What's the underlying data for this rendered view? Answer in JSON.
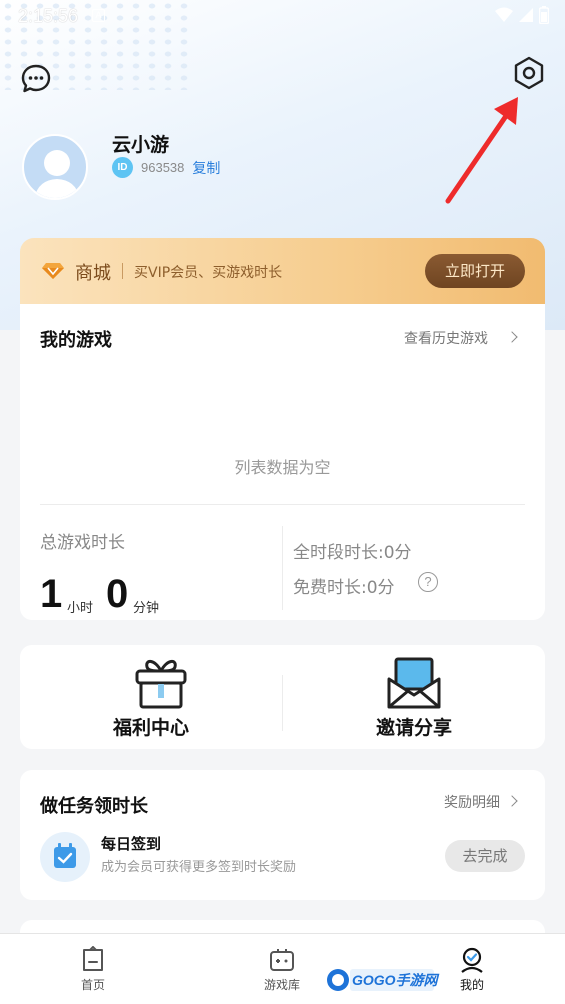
{
  "status_bar": {
    "time": "2:15:56",
    "notif_letter": "A"
  },
  "header": {
    "icons": [
      "chat-bubble-icon",
      "settings-hexagon-icon"
    ],
    "annotation": "red-arrow-pointing-to-settings"
  },
  "profile": {
    "username": "云小游",
    "id_badge": "ID",
    "id_number": "963538",
    "copy_label": "复制"
  },
  "mall": {
    "title": "商城",
    "subtitle": "买VIP会员、买游戏时长",
    "button_label": "立即打开",
    "colors": {
      "start": "#fbe3bd",
      "end": "#f1bb70",
      "button": "#7a4e28"
    }
  },
  "my_games": {
    "title": "我的游戏",
    "history_link": "查看历史游戏",
    "empty_text": "列表数据为空",
    "total_label": "总游戏时长",
    "hours_value": "1",
    "hours_unit": "小时",
    "minutes_value": "0",
    "minutes_unit": "分钟",
    "all_time_label": "全时段时长:0分",
    "free_time_label": "免费时长:0分",
    "help_symbol": "?"
  },
  "actions": {
    "welfare_label": "福利中心",
    "invite_label": "邀请分享"
  },
  "tasks": {
    "title": "做任务领时长",
    "reward_link": "奖励明细",
    "items": [
      {
        "name": "每日签到",
        "desc": "成为会员可获得更多签到时长奖励",
        "button": "去完成"
      }
    ]
  },
  "bottom_nav": {
    "items": [
      {
        "label": "首页",
        "icon": "home-icon"
      },
      {
        "label": "游戏库",
        "icon": "gamepad-icon"
      },
      {
        "label": "我的",
        "icon": "profile-icon"
      }
    ]
  },
  "watermark": "GOGO手游网"
}
